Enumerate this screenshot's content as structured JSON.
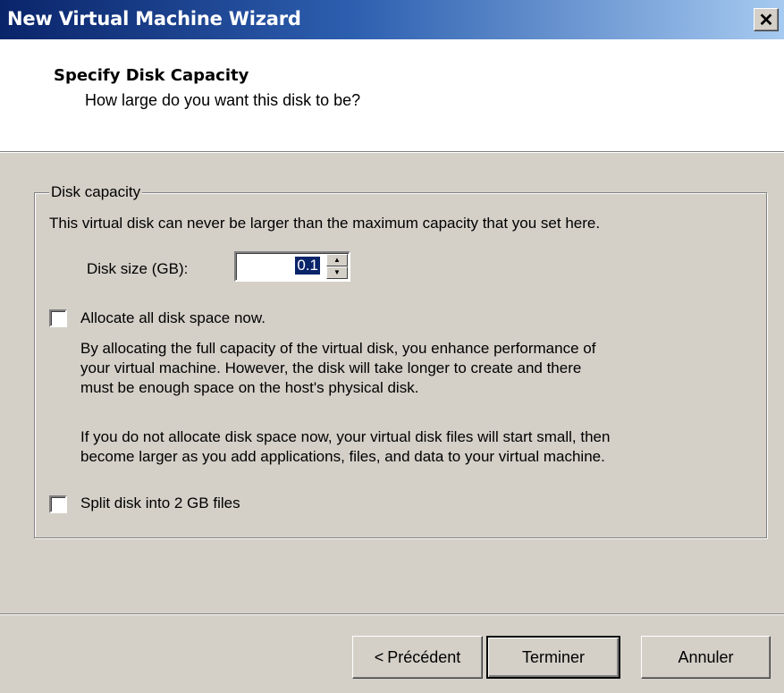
{
  "window": {
    "title": "New Virtual Machine Wizard",
    "close_glyph": "✕"
  },
  "header": {
    "title": "Specify Disk Capacity",
    "subtitle": "How large do you want this disk to be?"
  },
  "disk_capacity": {
    "legend": "Disk capacity",
    "description": "This virtual disk can never be larger than the maximum capacity that you set here.",
    "size_label": "Disk size (GB):",
    "size_value": "0.1"
  },
  "allocate": {
    "label": "Allocate all disk space now.",
    "checked": false,
    "desc_line1": "By allocating the full capacity of the virtual disk, you enhance performance of",
    "desc_line2": "your virtual machine.  However, the disk will take longer to create and there",
    "desc_line3": "must be enough space on the host's physical disk.",
    "note_line1": "If you do not allocate disk space now, your virtual disk files will start small, then",
    "note_line2": "become larger as you add applications, files, and data to your virtual machine."
  },
  "split": {
    "label": "Split disk into 2 GB files",
    "checked": false
  },
  "buttons": {
    "back_arrow": "<",
    "back": "Précédent",
    "finish": "Terminer",
    "cancel": "Annuler"
  }
}
